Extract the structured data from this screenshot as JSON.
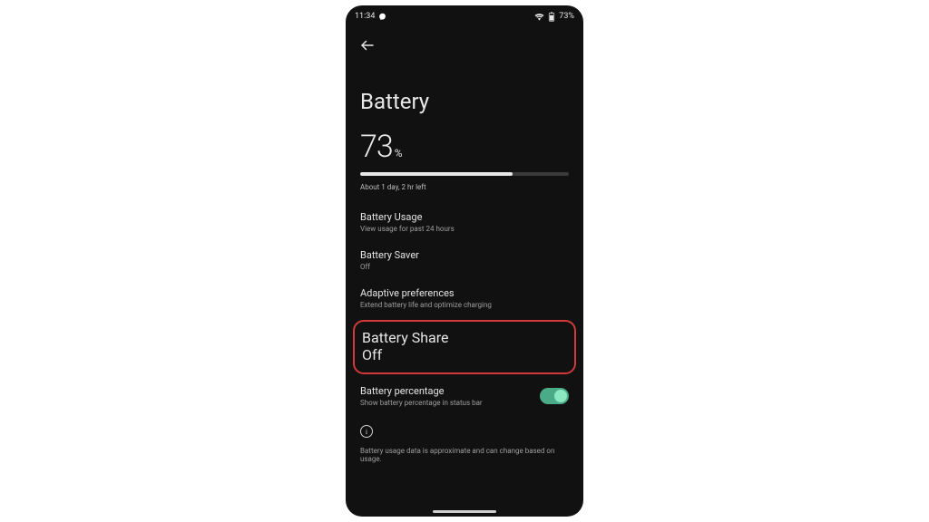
{
  "statusbar": {
    "time": "11:34",
    "battery_pct": "73%"
  },
  "header": {
    "title": "Battery"
  },
  "battery": {
    "percent_value": "73",
    "percent_symbol": "%",
    "fill_pct": 73,
    "estimate": "About 1 day, 2 hr left"
  },
  "items": {
    "usage": {
      "title": "Battery Usage",
      "sub": "View usage for past 24 hours"
    },
    "saver": {
      "title": "Battery Saver",
      "sub": "Off"
    },
    "adaptive": {
      "title": "Adaptive preferences",
      "sub": "Extend battery life and optimize charging"
    },
    "share": {
      "title": "Battery Share",
      "sub": "Off"
    },
    "percentage": {
      "title": "Battery percentage",
      "sub": "Show battery percentage in status bar",
      "on": true
    }
  },
  "footer": {
    "note": "Battery usage data is approximate and can change based on usage."
  }
}
